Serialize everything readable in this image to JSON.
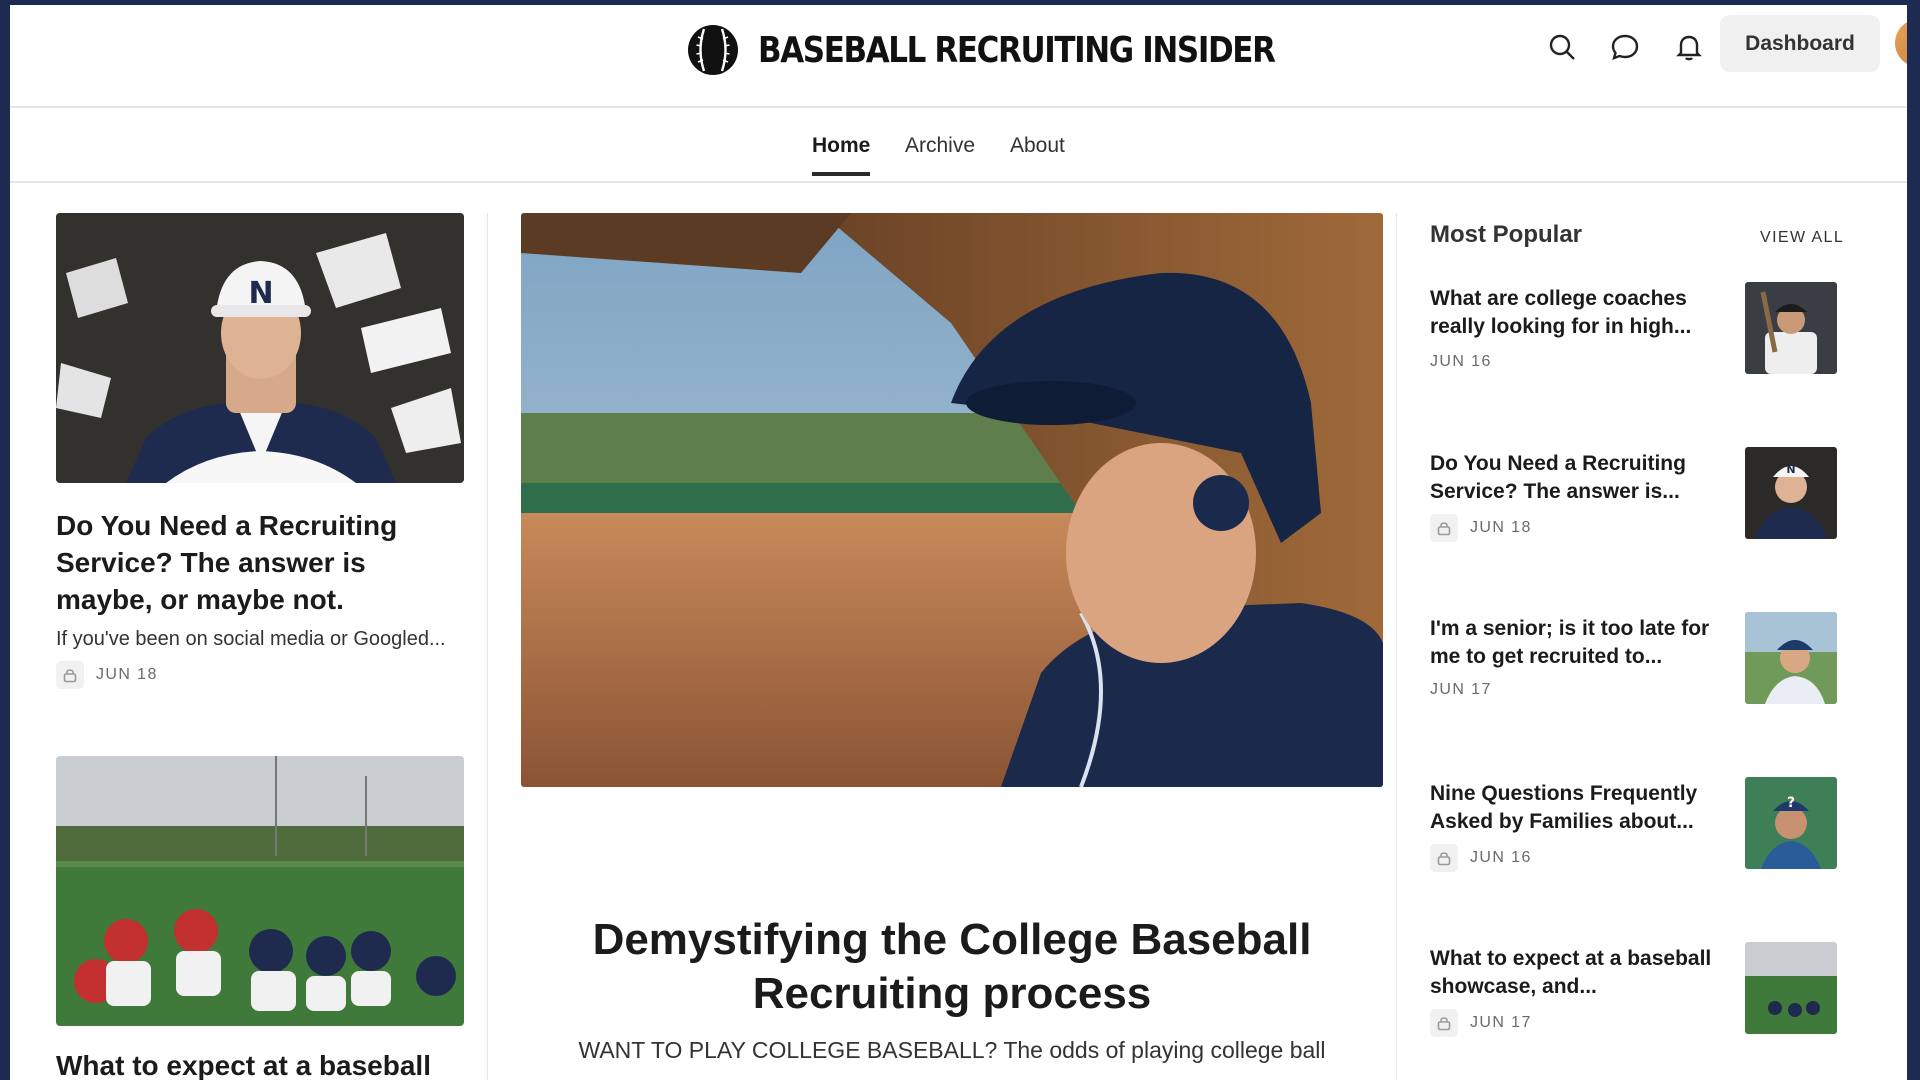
{
  "header": {
    "brand_name": "BASEBALL RECRUITING INSIDER",
    "dashboard_label": "Dashboard"
  },
  "nav": {
    "tabs": [
      {
        "label": "Home"
      },
      {
        "label": "Archive"
      },
      {
        "label": "About"
      }
    ]
  },
  "left_posts": [
    {
      "title": "Do You Need a Recruiting Service? The answer is maybe, or maybe not.",
      "subtitle": "If you've been on social media or Googled...",
      "date": "JUN 18",
      "locked": true
    },
    {
      "title": "What to expect at a baseball showcase, and...",
      "locked": true
    }
  ],
  "featured": {
    "title": "Demystifying the College Baseball Recruiting process",
    "subtitle": "WANT TO PLAY COLLEGE BASEBALL? The odds of playing college ball"
  },
  "popular": {
    "heading": "Most Popular",
    "view_all": "VIEW ALL",
    "items": [
      {
        "title": "What are college coaches really looking for in high...",
        "date": "JUN 16",
        "locked": false
      },
      {
        "title": "Do You Need a Recruiting Service? The answer is...",
        "date": "JUN 18",
        "locked": true
      },
      {
        "title": "I'm a senior; is it too late for me to get recruited to...",
        "date": "JUN 17",
        "locked": false
      },
      {
        "title": "Nine Questions Frequently Asked by Families about...",
        "date": "JUN 16",
        "locked": true
      },
      {
        "title": "What to expect at a baseball showcase, and...",
        "date": "JUN 17",
        "locked": true
      }
    ]
  },
  "icons": [
    "baseball-logo-icon",
    "search-icon",
    "chat-icon",
    "bell-icon",
    "lock-icon"
  ],
  "colors": {
    "frame": "#1d2a52",
    "navy": "#1b2a4a",
    "text": "#1b1b1b",
    "muted": "#6b6b6b"
  }
}
